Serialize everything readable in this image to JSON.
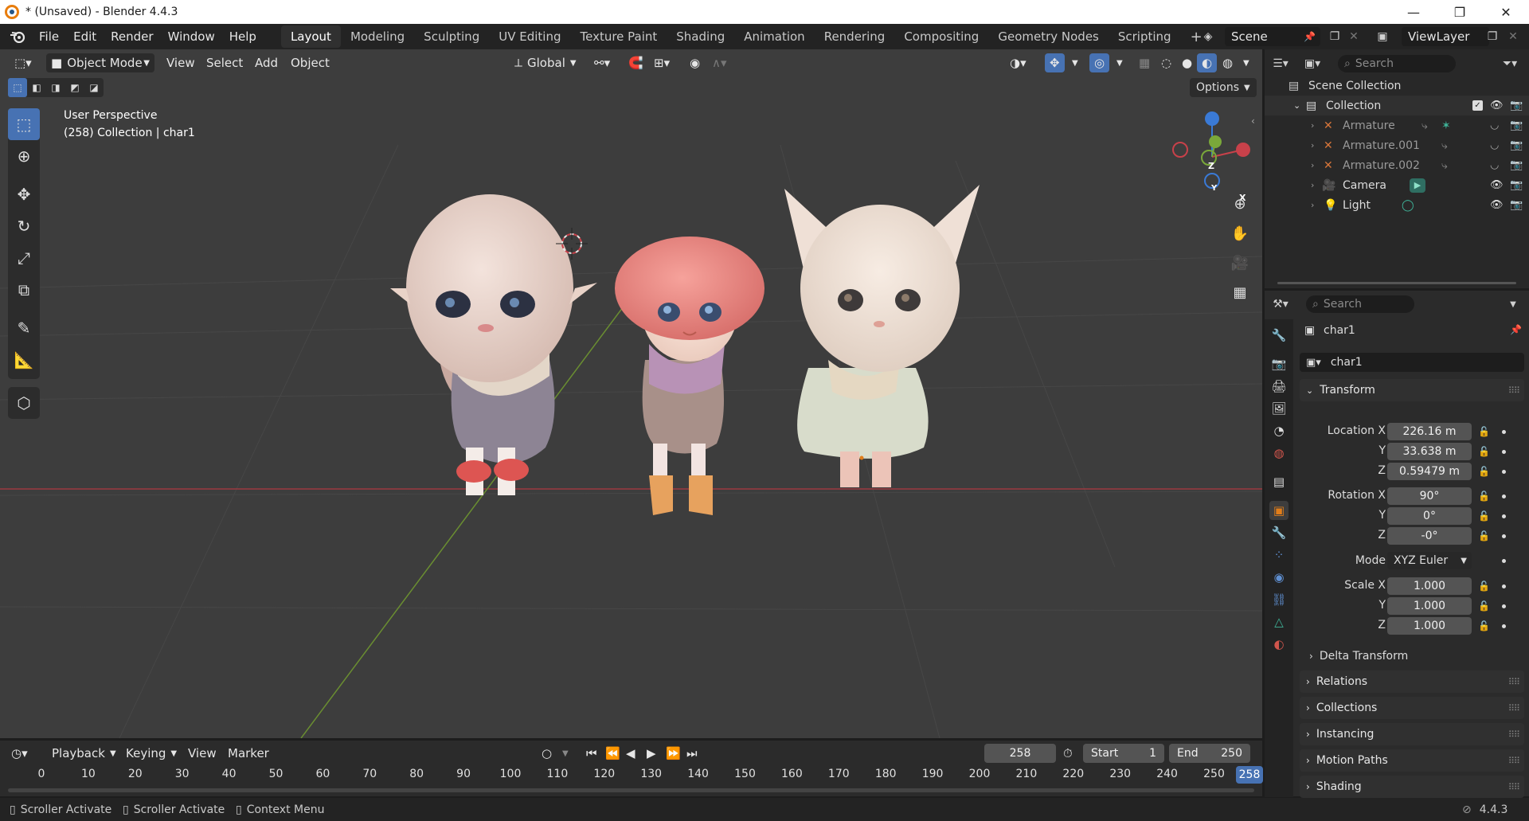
{
  "window": {
    "title": "* (Unsaved) - Blender 4.4.3",
    "minimize": "—",
    "maximize": "❐",
    "close": "✕"
  },
  "menu": [
    "File",
    "Edit",
    "Render",
    "Window",
    "Help"
  ],
  "workspaces": [
    {
      "label": "Layout",
      "active": true
    },
    {
      "label": "Modeling"
    },
    {
      "label": "Sculpting"
    },
    {
      "label": "UV Editing"
    },
    {
      "label": "Texture Paint"
    },
    {
      "label": "Shading"
    },
    {
      "label": "Animation"
    },
    {
      "label": "Rendering"
    },
    {
      "label": "Compositing"
    },
    {
      "label": "Geometry Nodes"
    },
    {
      "label": "Scripting"
    }
  ],
  "add_workspace": "+",
  "scene": {
    "name": "Scene",
    "view_layer": "ViewLayer"
  },
  "viewport": {
    "mode": "Object Mode",
    "menus": [
      "View",
      "Select",
      "Add",
      "Object"
    ],
    "orientation": "Global",
    "options": "Options",
    "perspective": "User Perspective",
    "context": "(258) Collection | char1",
    "gizmo": {
      "x": "X",
      "y": "Y",
      "z": "Z"
    }
  },
  "outliner": {
    "search_placeholder": "Search",
    "scene_collection": "Scene Collection",
    "collection": "Collection",
    "items": [
      {
        "name": "Armature",
        "icon": "armature-icon"
      },
      {
        "name": "Armature.001",
        "icon": "armature-icon"
      },
      {
        "name": "Armature.002",
        "icon": "armature-icon"
      },
      {
        "name": "Camera",
        "icon": "camera-icon"
      },
      {
        "name": "Light",
        "icon": "light-icon"
      }
    ]
  },
  "properties": {
    "search_placeholder": "Search",
    "object_name": "char1",
    "datablock_name": "char1",
    "transform_label": "Transform",
    "location": {
      "label": "Location X",
      "x": "226.16 m",
      "y": "33.638 m",
      "z": "0.59479 m"
    },
    "rotation": {
      "label": "Rotation X",
      "x": "90°",
      "y": "0°",
      "z": "-0°"
    },
    "mode_label": "Mode",
    "mode_value": "XYZ Euler",
    "scale": {
      "label": "Scale X",
      "x": "1.000",
      "y": "1.000",
      "z": "1.000"
    },
    "axis_y": "Y",
    "axis_z": "Z",
    "delta_transform": "Delta Transform",
    "panels": [
      "Relations",
      "Collections",
      "Instancing",
      "Motion Paths",
      "Shading"
    ]
  },
  "timeline": {
    "menus": [
      "Playback",
      "Keying",
      "View",
      "Marker"
    ],
    "current_frame": "258",
    "start_label": "Start",
    "start": "1",
    "end_label": "End",
    "end": "250",
    "ruler": [
      "0",
      "10",
      "20",
      "30",
      "40",
      "50",
      "60",
      "70",
      "80",
      "90",
      "100",
      "110",
      "120",
      "130",
      "140",
      "150",
      "160",
      "170",
      "180",
      "190",
      "200",
      "210",
      "220",
      "230",
      "240",
      "250"
    ],
    "playhead": "258"
  },
  "statusbar": {
    "items": [
      "Scroller Activate",
      "Scroller Activate",
      "Context Menu"
    ],
    "version": "4.4.3"
  },
  "colors": {
    "accent": "#4772b3",
    "viewport_bg": "#3d3d3d",
    "x_axis": "#c8414a",
    "y_axis": "#7aa83a",
    "z_axis": "#3a7ad6",
    "object_orange": "#e07d1a"
  }
}
